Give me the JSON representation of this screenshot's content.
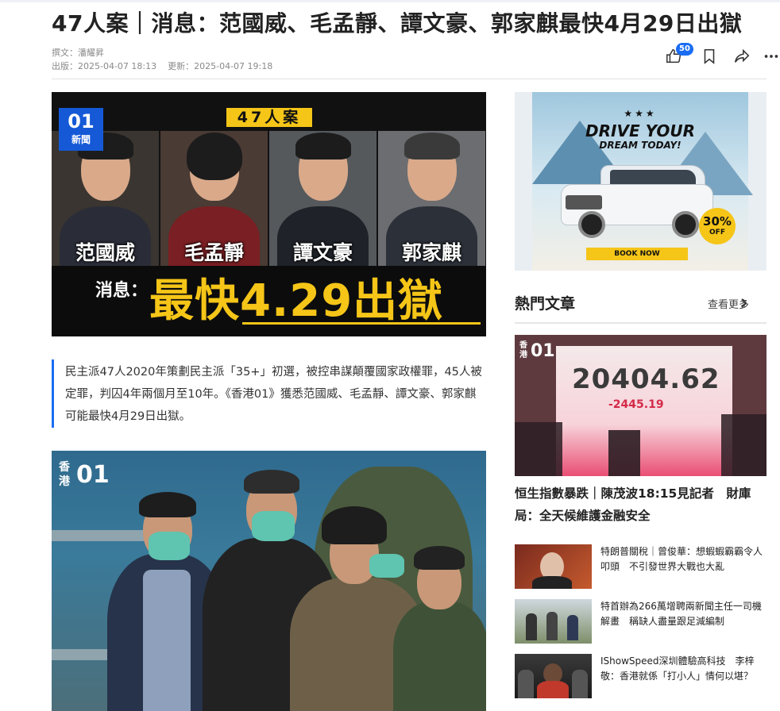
{
  "article": {
    "title": "47人案｜消息：范國威、毛孟靜、譚文豪、郭家麒最快4月29日出獄",
    "author_line": "撰文：潘耀昇",
    "published_line": "出版：2025-04-07 18:13",
    "updated_line": "更新：2025-04-07 19:18",
    "like_count": "50",
    "summary": "民主派47人2020年策劃民主派「35+」初選，被控串謀顛覆國家政權罪，45人被定罪，判囚4年兩個月至10年。《香港01》獲悉范國威、毛孟靜、譚文豪、郭家麒可能最快4月29日出獄。"
  },
  "hero": {
    "logo_main": "01",
    "logo_sub": "新聞",
    "tag": "47人案",
    "names": [
      "范國威",
      "毛孟靜",
      "譚文豪",
      "郭家麒"
    ],
    "news_label": "消息：",
    "headline": "最快4.29出獄"
  },
  "photo2": {
    "logo_zh_1": "香",
    "logo_zh_2": "港",
    "logo_main": "01"
  },
  "ad": {
    "stars": "★★★",
    "title": "DRIVE YOUR",
    "subtitle": "DREAM TODAY!",
    "badge_value": "30%",
    "badge_text": "OFF",
    "cta": "BOOK NOW"
  },
  "sidebar": {
    "section_title": "熱門文章",
    "more_label": "查看更多",
    "featured": {
      "logo_zh": "香港",
      "logo_main": "01",
      "screen_number": "20404.62",
      "screen_change": "-2445.19",
      "title": "恒生指數暴跌｜陳茂波18:15見記者　財庫局：全天候維護金融安全"
    },
    "items": [
      {
        "title": "特朗普關稅｜曾俊華：想蝦蝦霸霸令人叩頭　不引發世界大戰也大亂"
      },
      {
        "title": "特首辦為266萬增聘兩新聞主任一司機解畫　稱缺人盡量跟足減編制"
      },
      {
        "title": "IShowSpeed深圳體驗高科技　李梓敬：香港就係「打小人」情何以堪？"
      }
    ]
  },
  "colors": {
    "accent": "#1a6df3",
    "yellow": "#f5c518",
    "text": "#222222",
    "muted": "#8a8a8a"
  },
  "icons": {
    "like": "thumbs-up-icon",
    "bookmark": "bookmark-icon",
    "share": "share-icon",
    "more": "more-dots-icon",
    "chevron": "chevron-right-icon"
  }
}
